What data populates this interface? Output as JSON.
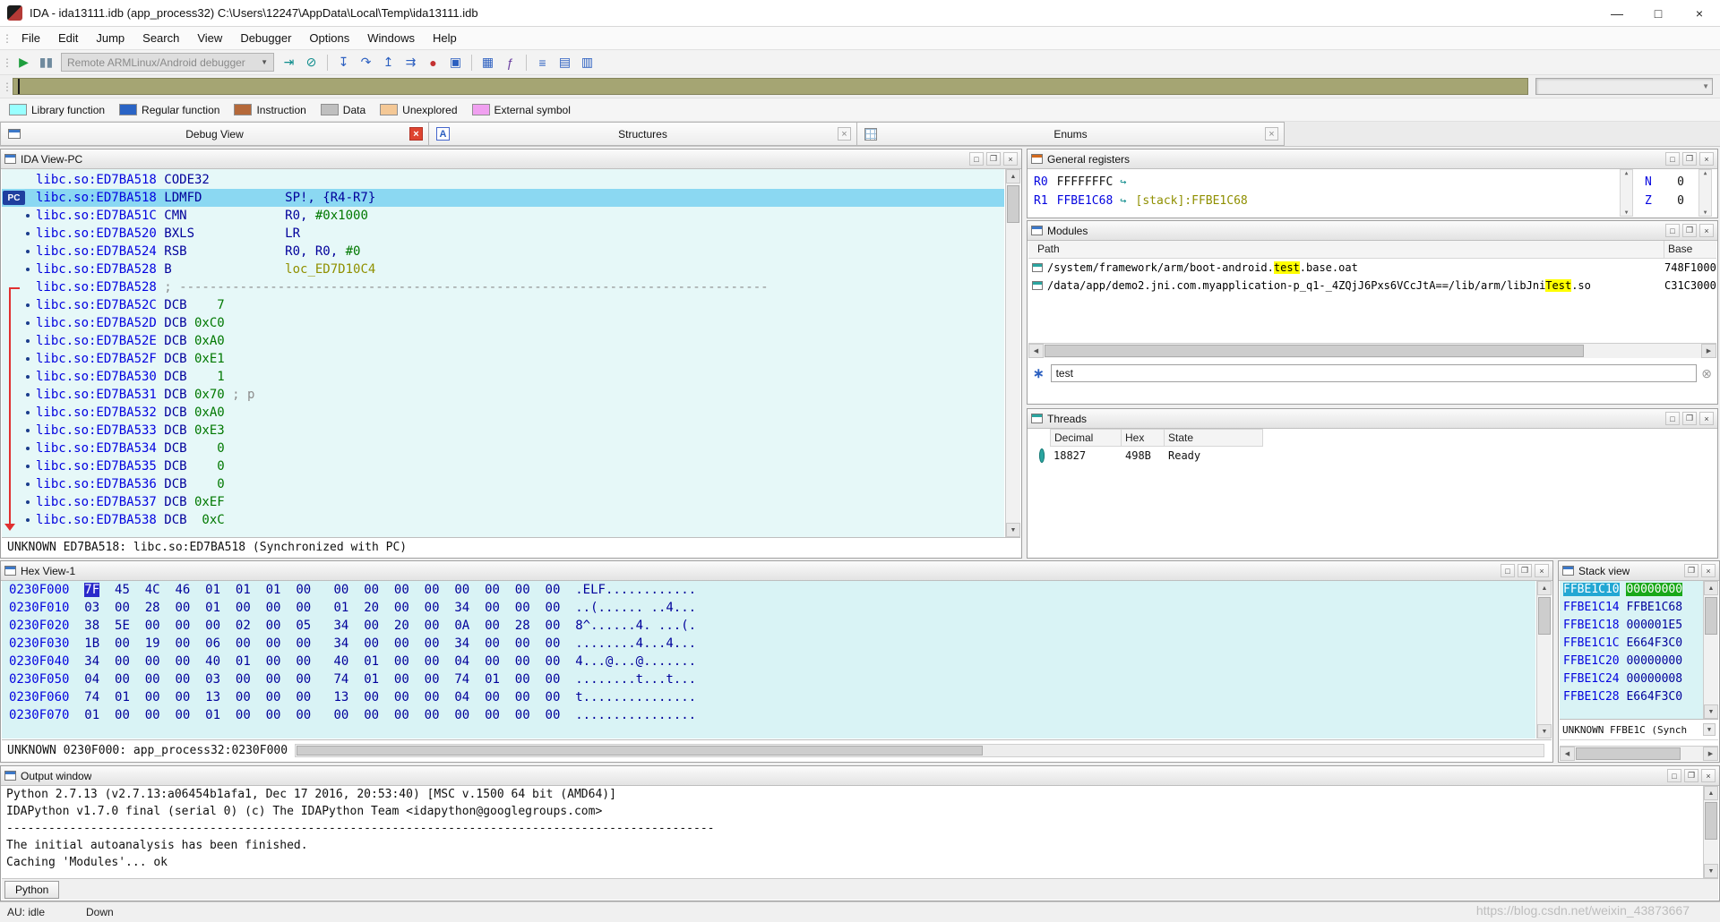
{
  "icons": {
    "window_minimize": "—",
    "window_maximize": "□",
    "window_close": "×",
    "panel_restore": "□",
    "panel_float": "❐",
    "panel_close": "×",
    "scroll_up": "▲",
    "scroll_down": "▼",
    "scroll_left": "◀",
    "scroll_right": "▶",
    "dropdown": "▼",
    "follow_arrow": "↪",
    "filter": "∗",
    "clear_filter": "⊗",
    "drag_handle": "⋮"
  },
  "titlebar": {
    "title": "IDA - ida13111.idb (app_process32) C:\\Users\\12247\\AppData\\Local\\Temp\\ida13111.idb"
  },
  "menu": {
    "items": [
      "File",
      "Edit",
      "Jump",
      "Search",
      "View",
      "Debugger",
      "Options",
      "Windows",
      "Help"
    ]
  },
  "toolbar": {
    "combo_value": "Remote ARMLinux/Android debugger",
    "icons": [
      {
        "name": "start-process-icon",
        "glyph": "▶",
        "color": "#1E9E3E"
      },
      {
        "name": "pause-process-icon",
        "glyph": "▮▮",
        "color": "#6F8A9E"
      },
      {
        "combo": true
      },
      {
        "name": "detach-debugger-icon",
        "glyph": "⇥",
        "color": "#0E8C8C"
      },
      {
        "name": "stop-process-icon",
        "glyph": "⊘",
        "color": "#0E8C8C"
      },
      {
        "sep": true
      },
      {
        "name": "step-into-icon",
        "glyph": "↧",
        "color": "#2B5FC0"
      },
      {
        "name": "step-over-icon",
        "glyph": "↷",
        "color": "#2B5FC0"
      },
      {
        "name": "run-until-return-icon",
        "glyph": "↥",
        "color": "#2B5FC0"
      },
      {
        "name": "run-to-cursor-icon",
        "glyph": "⇉",
        "color": "#2B5FC0"
      },
      {
        "name": "breakpoint-list-icon",
        "glyph": "●",
        "color": "#C43131"
      },
      {
        "name": "debugger-options-icon",
        "glyph": "▣",
        "color": "#2B5FC0"
      },
      {
        "sep": true
      },
      {
        "name": "open-subviews-icon",
        "glyph": "▦",
        "color": "#2B5FC0"
      },
      {
        "name": "scripts-icon",
        "glyph": "ƒ",
        "color": "#6A3FA0"
      },
      {
        "sep": true
      },
      {
        "name": "structures-toolbar-icon",
        "glyph": "≡",
        "color": "#2B5FC0"
      },
      {
        "name": "enums-toolbar-icon",
        "glyph": "▤",
        "color": "#2B5FC0"
      },
      {
        "name": "segments-toolbar-icon",
        "glyph": "▥",
        "color": "#2B5FC0"
      }
    ]
  },
  "legend": {
    "items": [
      {
        "label": "Library function",
        "color": "#99FFFF"
      },
      {
        "label": "Regular function",
        "color": "#2A64C5"
      },
      {
        "label": "Instruction",
        "color": "#B5693A"
      },
      {
        "label": "Data",
        "color": "#BFBFBF"
      },
      {
        "label": "Unexplored",
        "color": "#F4C896"
      },
      {
        "label": "External symbol",
        "color": "#F0A0F0"
      }
    ]
  },
  "tabbar": {
    "tabs": [
      {
        "name": "debug-view",
        "label": "Debug View",
        "icon": "window",
        "close_style": "red"
      },
      {
        "name": "structures",
        "label": "Structures",
        "icon": "A",
        "close_style": "gray"
      },
      {
        "name": "enums",
        "label": "Enums",
        "icon": "grid",
        "close_style": "gray"
      }
    ]
  },
  "ida_view": {
    "title": "IDA View-PC",
    "pc_badge": "PC",
    "status": "UNKNOWN ED7BA518: libc.so:ED7BA518 (Synchronized with PC)",
    "lines": [
      {
        "segs": [
          {
            "t": "libc.so:ED7BA518",
            "c": "addr"
          },
          {
            "t": " CODE32",
            "c": "code"
          }
        ]
      },
      {
        "pc": true,
        "hl": true,
        "segs": [
          {
            "t": "libc.so:ED7BA518",
            "c": "addr"
          },
          {
            "t": " LDMFD           SP!, {R4-R7}",
            "c": "code"
          }
        ]
      },
      {
        "dot": true,
        "segs": [
          {
            "t": "libc.so:ED7BA51C",
            "c": "addr"
          },
          {
            "t": " CMN             R0, ",
            "c": "code"
          },
          {
            "t": "#0x1000",
            "c": "imm"
          }
        ]
      },
      {
        "dot": true,
        "segs": [
          {
            "t": "libc.so:ED7BA520",
            "c": "addr"
          },
          {
            "t": " BXLS            LR",
            "c": "code"
          }
        ]
      },
      {
        "dot": true,
        "segs": [
          {
            "t": "libc.so:ED7BA524",
            "c": "addr"
          },
          {
            "t": " RSB             R0, R0, ",
            "c": "code"
          },
          {
            "t": "#0",
            "c": "imm"
          }
        ]
      },
      {
        "dot": true,
        "segs": [
          {
            "t": "libc.so:ED7BA528",
            "c": "addr"
          },
          {
            "t": " B               ",
            "c": "code"
          },
          {
            "t": "loc_ED7D10C4",
            "c": "loc"
          }
        ]
      },
      {
        "segs": [
          {
            "t": "libc.so:ED7BA528",
            "c": "addr"
          },
          {
            "t": " ; ------------------------------------------------------------------------------",
            "c": "comment"
          }
        ]
      },
      {
        "dot": true,
        "segs": [
          {
            "t": "libc.so:ED7BA52C",
            "c": "addr"
          },
          {
            "t": " DCB",
            "c": "code"
          },
          {
            "t": "    7",
            "c": "imm"
          }
        ]
      },
      {
        "dot": true,
        "segs": [
          {
            "t": "libc.so:ED7BA52D",
            "c": "addr"
          },
          {
            "t": " DCB",
            "c": "code"
          },
          {
            "t": " 0xC0",
            "c": "imm"
          }
        ]
      },
      {
        "dot": true,
        "segs": [
          {
            "t": "libc.so:ED7BA52E",
            "c": "addr"
          },
          {
            "t": " DCB",
            "c": "code"
          },
          {
            "t": " 0xA0",
            "c": "imm"
          }
        ]
      },
      {
        "dot": true,
        "segs": [
          {
            "t": "libc.so:ED7BA52F",
            "c": "addr"
          },
          {
            "t": " DCB",
            "c": "code"
          },
          {
            "t": " 0xE1",
            "c": "imm"
          }
        ]
      },
      {
        "dot": true,
        "segs": [
          {
            "t": "libc.so:ED7BA530",
            "c": "addr"
          },
          {
            "t": " DCB",
            "c": "code"
          },
          {
            "t": "    1",
            "c": "imm"
          }
        ]
      },
      {
        "dot": true,
        "segs": [
          {
            "t": "libc.so:ED7BA531",
            "c": "addr"
          },
          {
            "t": " DCB",
            "c": "code"
          },
          {
            "t": " 0x70",
            "c": "imm"
          },
          {
            "t": " ; p",
            "c": "comment"
          }
        ]
      },
      {
        "dot": true,
        "segs": [
          {
            "t": "libc.so:ED7BA532",
            "c": "addr"
          },
          {
            "t": " DCB",
            "c": "code"
          },
          {
            "t": " 0xA0",
            "c": "imm"
          }
        ]
      },
      {
        "dot": true,
        "segs": [
          {
            "t": "libc.so:ED7BA533",
            "c": "addr"
          },
          {
            "t": " DCB",
            "c": "code"
          },
          {
            "t": " 0xE3",
            "c": "imm"
          }
        ]
      },
      {
        "dot": true,
        "segs": [
          {
            "t": "libc.so:ED7BA534",
            "c": "addr"
          },
          {
            "t": " DCB",
            "c": "code"
          },
          {
            "t": "    0",
            "c": "imm"
          }
        ]
      },
      {
        "dot": true,
        "segs": [
          {
            "t": "libc.so:ED7BA535",
            "c": "addr"
          },
          {
            "t": " DCB",
            "c": "code"
          },
          {
            "t": "    0",
            "c": "imm"
          }
        ]
      },
      {
        "dot": true,
        "segs": [
          {
            "t": "libc.so:ED7BA536",
            "c": "addr"
          },
          {
            "t": " DCB",
            "c": "code"
          },
          {
            "t": "    0",
            "c": "imm"
          }
        ]
      },
      {
        "dot": true,
        "segs": [
          {
            "t": "libc.so:ED7BA537",
            "c": "addr"
          },
          {
            "t": " DCB",
            "c": "code"
          },
          {
            "t": " 0xEF",
            "c": "imm"
          }
        ]
      },
      {
        "dot": true,
        "segs": [
          {
            "t": "libc.so:ED7BA538",
            "c": "addr"
          },
          {
            "t": " DCB",
            "c": "code"
          },
          {
            "t": "  0xC",
            "c": "imm"
          }
        ]
      }
    ]
  },
  "registers": {
    "title": "General registers",
    "rows": [
      {
        "reg": "R0",
        "value": "FFFFFFFC",
        "value_color": "black",
        "extra": null
      },
      {
        "reg": "R1",
        "value": "FFBE1C68",
        "value_color": "blue",
        "extra": "[stack]:FFBE1C68"
      }
    ],
    "flags": [
      {
        "flag": "N",
        "value": "0"
      },
      {
        "flag": "Z",
        "value": "0"
      }
    ]
  },
  "modules": {
    "title": "Modules",
    "columns": [
      "Path",
      "Base"
    ],
    "rows": [
      {
        "path_parts": [
          {
            "t": "/system/framework/arm/boot-android."
          },
          {
            "t": "test",
            "hl": true
          },
          {
            "t": ".base.oat"
          }
        ],
        "base": "748F1000"
      },
      {
        "path_parts": [
          {
            "t": "/data/app/demo2.jni.com.myapplication-p_q1-_4ZQjJ6Pxs6VCcJtA==/lib/arm/libJni"
          },
          {
            "t": "Test",
            "hl": true
          },
          {
            "t": ".so"
          }
        ],
        "base": "C31C3000"
      }
    ],
    "filter": {
      "value": "test"
    }
  },
  "threads": {
    "title": "Threads",
    "columns": [
      "Decimal",
      "Hex",
      "State"
    ],
    "rows": [
      {
        "decimal": "18827",
        "hex": "498B",
        "state": "Ready"
      }
    ]
  },
  "hex_view": {
    "title": "Hex View-1",
    "status": "UNKNOWN 0230F000: app_process32:0230F000",
    "selection": {
      "row": 0,
      "byte": 0
    },
    "rows": [
      {
        "addr": "0230F000",
        "bytes": [
          "7F",
          "45",
          "4C",
          "46",
          "01",
          "01",
          "01",
          "00",
          "00",
          "00",
          "00",
          "00",
          "00",
          "00",
          "00",
          "00"
        ],
        "ascii": ".ELF............"
      },
      {
        "addr": "0230F010",
        "bytes": [
          "03",
          "00",
          "28",
          "00",
          "01",
          "00",
          "00",
          "00",
          "01",
          "20",
          "00",
          "00",
          "34",
          "00",
          "00",
          "00"
        ],
        "ascii": "..(...... ..4..."
      },
      {
        "addr": "0230F020",
        "bytes": [
          "38",
          "5E",
          "00",
          "00",
          "00",
          "02",
          "00",
          "05",
          "34",
          "00",
          "20",
          "00",
          "0A",
          "00",
          "28",
          "00"
        ],
        "ascii": "8^......4. ...(."
      },
      {
        "addr": "0230F030",
        "bytes": [
          "1B",
          "00",
          "19",
          "00",
          "06",
          "00",
          "00",
          "00",
          "34",
          "00",
          "00",
          "00",
          "34",
          "00",
          "00",
          "00"
        ],
        "ascii": "........4...4..."
      },
      {
        "addr": "0230F040",
        "bytes": [
          "34",
          "00",
          "00",
          "00",
          "40",
          "01",
          "00",
          "00",
          "40",
          "01",
          "00",
          "00",
          "04",
          "00",
          "00",
          "00"
        ],
        "ascii": "4...@...@......."
      },
      {
        "addr": "0230F050",
        "bytes": [
          "04",
          "00",
          "00",
          "00",
          "03",
          "00",
          "00",
          "00",
          "74",
          "01",
          "00",
          "00",
          "74",
          "01",
          "00",
          "00"
        ],
        "ascii": "........t...t..."
      },
      {
        "addr": "0230F060",
        "bytes": [
          "74",
          "01",
          "00",
          "00",
          "13",
          "00",
          "00",
          "00",
          "13",
          "00",
          "00",
          "00",
          "04",
          "00",
          "00",
          "00"
        ],
        "ascii": "t..............."
      },
      {
        "addr": "0230F070",
        "bytes": [
          "01",
          "00",
          "00",
          "00",
          "01",
          "00",
          "00",
          "00",
          "00",
          "00",
          "00",
          "00",
          "00",
          "00",
          "00",
          "00"
        ],
        "ascii": "................"
      }
    ]
  },
  "stack_view": {
    "title": "Stack view",
    "status": "UNKNOWN FFBE1C (Synch",
    "rows": [
      {
        "addr": "FFBE1C10",
        "value": "00000000",
        "sel": true
      },
      {
        "addr": "FFBE1C14",
        "value": "FFBE1C68"
      },
      {
        "addr": "FFBE1C18",
        "value": "000001E5"
      },
      {
        "addr": "FFBE1C1C",
        "value": "E664F3C0"
      },
      {
        "addr": "FFBE1C20",
        "value": "00000000"
      },
      {
        "addr": "FFBE1C24",
        "value": "00000008"
      },
      {
        "addr": "FFBE1C28",
        "value": "E664F3C0"
      }
    ]
  },
  "output": {
    "title": "Output window",
    "tab_label": "Python",
    "lines": [
      "Python 2.7.13 (v2.7.13:a06454b1afa1, Dec 17 2016, 20:53:40) [MSC v.1500 64 bit (AMD64)]",
      "IDAPython v1.7.0 final (serial 0) (c) The IDAPython Team <idapython@googlegroups.com>",
      "-----------------------------------------------------------------------------------------------------",
      "The initial autoanalysis has been finished.",
      "Caching 'Modules'... ok"
    ]
  },
  "statusbar": {
    "au": "AU: idle",
    "down": "Down",
    "watermark": "https://blog.csdn.net/weixin_43873667"
  }
}
